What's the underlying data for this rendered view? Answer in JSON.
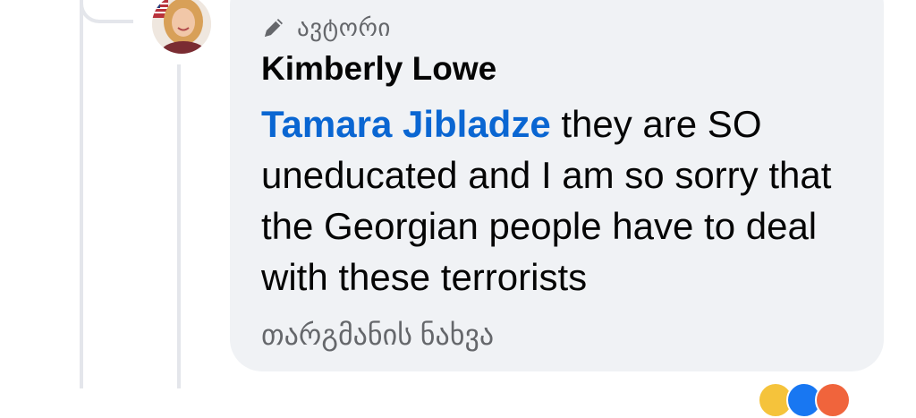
{
  "comment": {
    "badge_label": "ავტორი",
    "badge_icon": "pencil-icon",
    "author_name": "Kimberly Lowe",
    "mention": "Tamara Jibladze",
    "text": " they are SO uneducated and I am so sorry that the Georgian people have to deal with these terrorists",
    "translate_link": "თარგმანის ნახვა"
  },
  "colors": {
    "bubble": "#f0f2f5",
    "mention": "#0a66d2",
    "text": "#050505",
    "secondary": "#65676b",
    "thread_line": "#e4e6eb"
  }
}
